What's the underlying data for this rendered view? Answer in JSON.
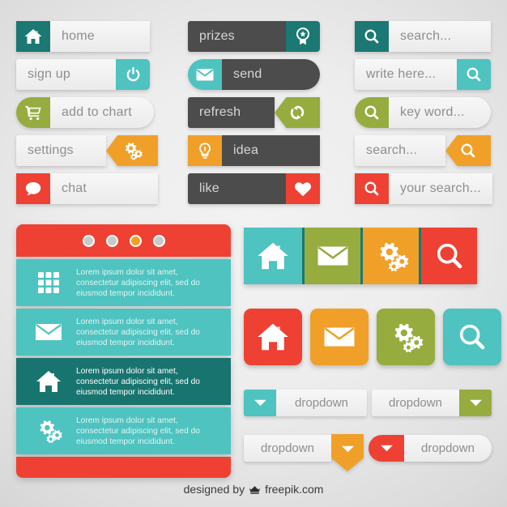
{
  "buttons_left": [
    {
      "label": "home",
      "icon": "home-icon",
      "icon_color": "#1b7872",
      "style": "icon-left-square"
    },
    {
      "label": "sign up",
      "icon": "power-icon",
      "icon_color": "#4ec3c0",
      "style": "icon-right-rounded"
    },
    {
      "label": "add to chart",
      "icon": "cart-icon",
      "icon_color": "#96ac3f",
      "style": "icon-left-pill"
    },
    {
      "label": "settings",
      "icon": "gears-icon",
      "icon_color": "#f0a028",
      "style": "icon-right-arrow"
    },
    {
      "label": "chat",
      "icon": "chat-icon",
      "icon_color": "#ee4133",
      "style": "icon-left-square"
    }
  ],
  "buttons_middle": [
    {
      "label": "prizes",
      "icon": "award-icon",
      "icon_color": "#1b7872",
      "style": "icon-right-square"
    },
    {
      "label": "send",
      "icon": "mail-icon",
      "icon_color": "#4ec3c0",
      "style": "icon-left-pill"
    },
    {
      "label": "refresh",
      "icon": "refresh-icon",
      "icon_color": "#96ac3f",
      "style": "icon-right-arrow"
    },
    {
      "label": "idea",
      "icon": "bulb-icon",
      "icon_color": "#f0a028",
      "style": "icon-left-square"
    },
    {
      "label": "like",
      "icon": "heart-icon",
      "icon_color": "#ee4133",
      "style": "icon-right-square"
    }
  ],
  "search_fields": [
    {
      "placeholder": "search...",
      "icon": "search-icon",
      "icon_color": "#1b7872",
      "style": "icon-left-square"
    },
    {
      "placeholder": "write here...",
      "icon": "search-icon",
      "icon_color": "#4ec3c0",
      "style": "icon-right-square"
    },
    {
      "placeholder": "key word...",
      "icon": "search-icon",
      "icon_color": "#96ac3f",
      "style": "icon-left-pill"
    },
    {
      "placeholder": "search...",
      "icon": "search-icon",
      "icon_color": "#f0a028",
      "style": "icon-right-arrow"
    },
    {
      "placeholder": "your search...",
      "icon": "search-icon",
      "icon_color": "#ee4133",
      "style": "icon-left-square"
    }
  ],
  "panel": {
    "header_color": "#ee4133",
    "footer_color": "#ee4133",
    "dots": [
      {
        "name": "dot-1",
        "active": false
      },
      {
        "name": "dot-2",
        "active": false
      },
      {
        "name": "dot-3",
        "active": true
      },
      {
        "name": "dot-4",
        "active": false
      }
    ],
    "rows": [
      {
        "icon": "grid-icon",
        "text": "Lorem ipsum dolor sit amet, consectetur adipiscing elit, sed do eiusmod tempor incididunt.",
        "selected": false
      },
      {
        "icon": "mail-icon",
        "text": "Lorem ipsum dolor sit amet, consectetur adipiscing elit, sed do eiusmod tempor incididunt.",
        "selected": false
      },
      {
        "icon": "home-icon",
        "text": "Lorem ipsum dolor sit amet, consectetur adipiscing elit, sed do eiusmod tempor incididunt.",
        "selected": true
      },
      {
        "icon": "gears-icon",
        "text": "Lorem ipsum dolor sit amet, consectetur adipiscing elit, sed do eiusmod tempor incididunt.",
        "selected": false
      }
    ]
  },
  "icon_row_flat": [
    {
      "icon": "home-icon",
      "color": "#4ec3c0"
    },
    {
      "icon": "mail-icon",
      "color": "#96ac3f"
    },
    {
      "icon": "gears-icon",
      "color": "#f0a028"
    },
    {
      "icon": "search-icon",
      "color": "#ee4133"
    }
  ],
  "icon_row_rounded": [
    {
      "icon": "home-icon",
      "color": "#ee4133"
    },
    {
      "icon": "mail-icon",
      "color": "#f0a028"
    },
    {
      "icon": "gears-icon",
      "color": "#96ac3f"
    },
    {
      "icon": "search-icon",
      "color": "#4ec3c0"
    }
  ],
  "dropdowns": [
    {
      "label": "dropdown",
      "icon": "chevron-down-icon",
      "color": "#4ec3c0",
      "side": "left",
      "shape": "square"
    },
    {
      "label": "dropdown",
      "icon": "chevron-down-icon",
      "color": "#96ac3f",
      "side": "right",
      "shape": "square"
    },
    {
      "label": "dropdown",
      "icon": "chevron-down-icon",
      "color": "#f0a028",
      "side": "right",
      "shape": "pentagon-down"
    },
    {
      "label": "dropdown",
      "icon": "chevron-down-icon",
      "color": "#ee4133",
      "side": "left",
      "shape": "rounded-cap"
    }
  ],
  "footer": {
    "prefix": "designed by",
    "icon": "freepik-crown-icon",
    "brand": "freepik.com"
  },
  "palette": {
    "teal_dark": "#1b7872",
    "teal": "#4ec3c0",
    "green": "#96ac3f",
    "orange": "#f0a028",
    "red": "#ee4133",
    "charcoal": "#4c4c4c",
    "light": "#f2f2f2"
  }
}
